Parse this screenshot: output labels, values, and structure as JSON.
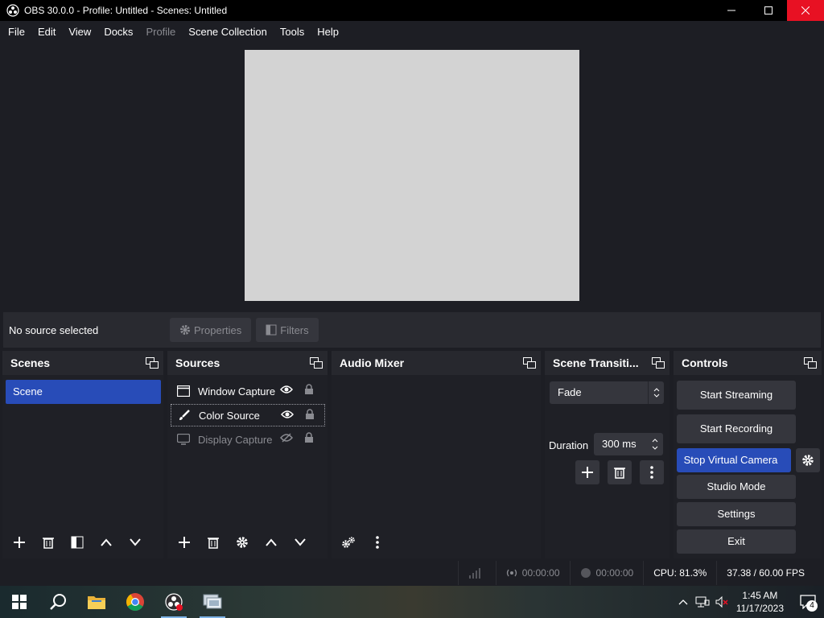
{
  "window": {
    "title": "OBS 30.0.0 - Profile: Untitled - Scenes: Untitled",
    "close_color": "#e81123"
  },
  "menu": {
    "items": [
      "File",
      "Edit",
      "View",
      "Docks",
      "Profile",
      "Scene Collection",
      "Tools",
      "Help"
    ],
    "disabled": [
      "Profile"
    ]
  },
  "context_bar": {
    "no_source": "No source selected",
    "properties": "Properties",
    "filters": "Filters"
  },
  "docks": {
    "scenes": {
      "title": "Scenes",
      "items": [
        "Scene"
      ],
      "selected": "Scene"
    },
    "sources": {
      "title": "Sources",
      "items": [
        {
          "name": "Window Capture",
          "icon": "window-icon",
          "visible": true,
          "locked": true
        },
        {
          "name": "Color Source",
          "icon": "paint-brush-icon",
          "visible": true,
          "locked": true,
          "selected": true
        },
        {
          "name": "Display Capture",
          "icon": "monitor-icon",
          "visible": false,
          "locked": true
        }
      ]
    },
    "audio_mixer": {
      "title": "Audio Mixer"
    },
    "transitions": {
      "title": "Scene Transiti...",
      "selected": "Fade",
      "duration_label": "Duration",
      "duration_value": "300 ms"
    },
    "controls": {
      "title": "Controls",
      "start_streaming": "Start Streaming",
      "start_recording": "Start Recording",
      "stop_virtual_camera": "Stop Virtual Camera",
      "studio_mode": "Studio Mode",
      "settings": "Settings",
      "exit": "Exit"
    }
  },
  "status": {
    "stream_time": "00:00:00",
    "record_time": "00:00:00",
    "cpu": "CPU: 81.3%",
    "fps": "37.38 / 60.00 FPS"
  },
  "taskbar": {
    "time": "1:45 AM",
    "date": "11/17/2023",
    "notifications": "4"
  },
  "colors": {
    "accent": "#284cb8",
    "panel": "#2b2c33",
    "background": "#1d1e24",
    "preview": "#d3d3d3"
  }
}
